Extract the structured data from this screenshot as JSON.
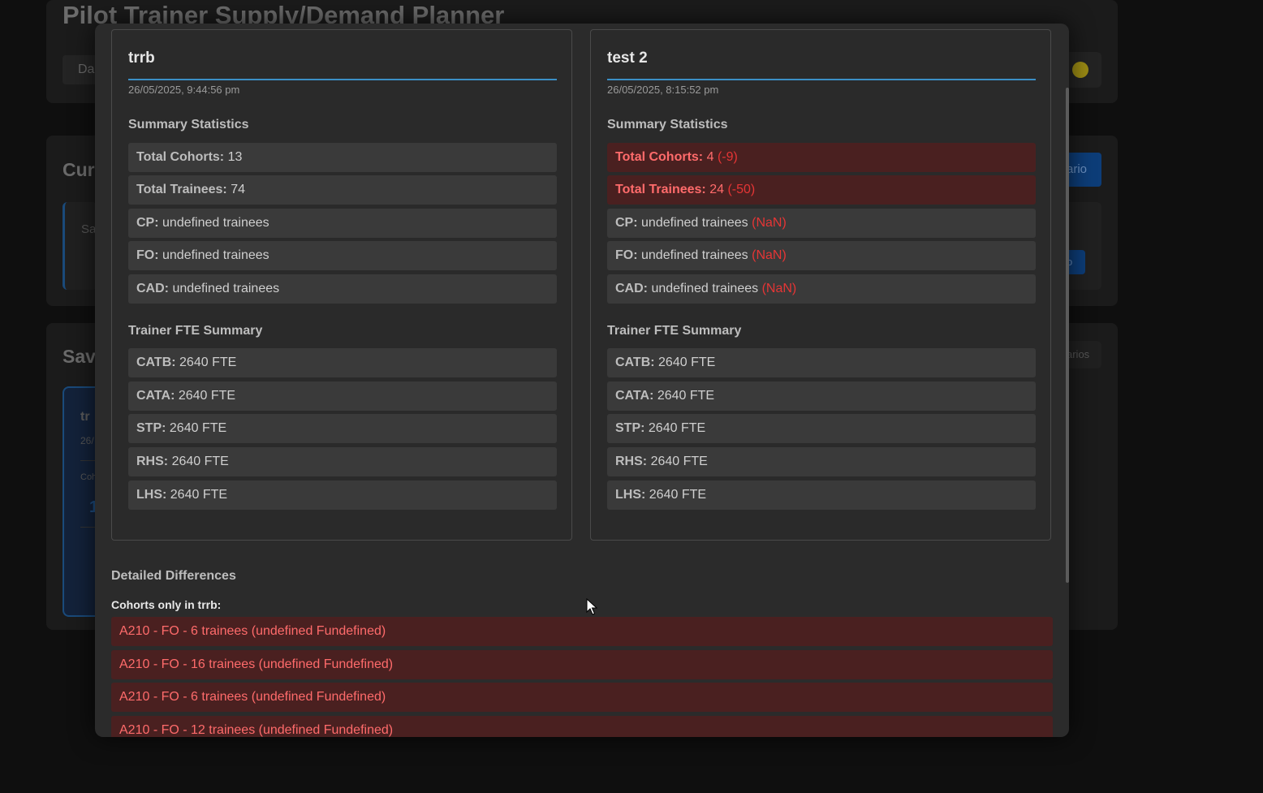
{
  "app": {
    "title": "Pilot Trainer Supply/Demand Planner",
    "tab_label": "Da",
    "current_heading": "Cur",
    "saved_heading": "Sav",
    "new_scenario_label": "ario",
    "inner_text": "Sa",
    "blue_small_btn": "o",
    "scenarios_label": "arios",
    "card_name": "tr",
    "card_date": "26/",
    "card_cohort_label": "Coh",
    "card_value": "1"
  },
  "compare": {
    "left": {
      "name": "trrb",
      "date": "26/05/2025, 9:44:56 pm",
      "summary_title": "Summary Statistics",
      "stats": [
        {
          "label": "Total Cohorts:",
          "value": "13",
          "delta": ""
        },
        {
          "label": "Total Trainees:",
          "value": "74",
          "delta": ""
        },
        {
          "label": "CP:",
          "value": "undefined trainees",
          "delta": ""
        },
        {
          "label": "FO:",
          "value": "undefined trainees",
          "delta": ""
        },
        {
          "label": "CAD:",
          "value": "undefined trainees",
          "delta": ""
        }
      ],
      "fte_title": "Trainer FTE Summary",
      "fte": [
        {
          "label": "CATB:",
          "value": "2640 FTE"
        },
        {
          "label": "CATA:",
          "value": "2640 FTE"
        },
        {
          "label": "STP:",
          "value": "2640 FTE"
        },
        {
          "label": "RHS:",
          "value": "2640 FTE"
        },
        {
          "label": "LHS:",
          "value": "2640 FTE"
        }
      ]
    },
    "right": {
      "name": "test 2",
      "date": "26/05/2025, 8:15:52 pm",
      "summary_title": "Summary Statistics",
      "stats": [
        {
          "label": "Total Cohorts:",
          "value": "4",
          "delta": "(-9)"
        },
        {
          "label": "Total Trainees:",
          "value": "24",
          "delta": "(-50)"
        },
        {
          "label": "CP:",
          "value": "undefined trainees",
          "delta": "(NaN)"
        },
        {
          "label": "FO:",
          "value": "undefined trainees",
          "delta": "(NaN)"
        },
        {
          "label": "CAD:",
          "value": "undefined trainees",
          "delta": "(NaN)"
        }
      ],
      "fte_title": "Trainer FTE Summary",
      "fte": [
        {
          "label": "CATB:",
          "value": "2640 FTE"
        },
        {
          "label": "CATA:",
          "value": "2640 FTE"
        },
        {
          "label": "STP:",
          "value": "2640 FTE"
        },
        {
          "label": "RHS:",
          "value": "2640 FTE"
        },
        {
          "label": "LHS:",
          "value": "2640 FTE"
        }
      ]
    },
    "details_title": "Detailed Differences",
    "only_in_label": "Cohorts only in trrb:",
    "only_in_rows": [
      "A210 - FO - 6 trainees (undefined Fundefined)",
      "A210 - FO - 16 trainees (undefined Fundefined)",
      "A210 - FO - 6 trainees (undefined Fundefined)",
      "A210 - FO - 12 trainees (undefined Fundefined)"
    ]
  },
  "colors": {
    "accent_blue": "#3b8fc6",
    "diff_bg": "#4a2020",
    "diff_text": "#ff6b6b",
    "delta_red": "#e53535"
  }
}
